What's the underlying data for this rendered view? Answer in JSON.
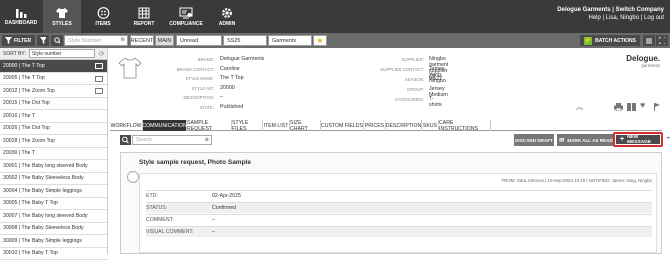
{
  "nav": {
    "items": [
      {
        "label": "DASHBOARD",
        "icon": "bar-chart-icon"
      },
      {
        "label": "STYLES",
        "icon": "shirt-icon"
      },
      {
        "label": "ITEMS",
        "icon": "buttons-icon"
      },
      {
        "label": "REPORT",
        "icon": "table-icon"
      },
      {
        "label": "COMPLIANCE",
        "icon": "compliance-icon"
      },
      {
        "label": "ADMIN",
        "icon": "gear-icon"
      }
    ],
    "company_line": "Delogue Garments | Switch Company",
    "user_line": "Help | Lisa, Ningbo | Log out"
  },
  "filterbar": {
    "filter_label": "FILTER",
    "search_placeholder": "Style Number",
    "recent_label": "RECENT",
    "main_label": "MAIN",
    "status_value": "Unread",
    "season_value": "SS25",
    "brand_value": "Garments",
    "batch_label": "BATCH ACTIONS"
  },
  "sort": {
    "label": "SORT BY:",
    "value": "Style number"
  },
  "styles_list": [
    "20000 | The T Top",
    "20005 | The T Top",
    "20012 | The Zoom Top",
    "20015 | The Dot Top",
    "20016 | The T",
    "20026 | The Dot Top",
    "20028 | The Zoom Top",
    "20030 | The T",
    "30001 | The Baby long sleeved Body",
    "30002 | The Baby Sleeveless Body",
    "30004 | The Baby Simple leggings",
    "30005 | The Baby T Top",
    "30007 | The Baby long sleeved Body",
    "30008 | The Baby Sleeveless Body",
    "30009 | The Baby Simple leggings",
    "30010 | The Baby T Top"
  ],
  "details_left": [
    {
      "k": "BRAND:",
      "v": "Delogue Garments"
    },
    {
      "k": "BRAND CONTACT:",
      "v": "Caroline"
    },
    {
      "k": "STYLE NAME:",
      "v": "The T Top"
    },
    {
      "k": "STYLE NO:",
      "v": "20000"
    },
    {
      "k": "DESCRIPTION:",
      "v": "–"
    },
    {
      "k": "STATE:",
      "v": "Published"
    }
  ],
  "details_right": [
    {
      "k": "SUPPLIER:",
      "v": "Ningbo garment supplier (2)"
    },
    {
      "k": "SUPPLIER CONTACT:",
      "v": "James Yang, Ningbo"
    },
    {
      "k": "SEASON:",
      "v": "SS27"
    },
    {
      "k": "GROUP:",
      "v": "Jersey Medium"
    },
    {
      "k": "CATEGORIES:",
      "v": "T-shirts"
    }
  ],
  "logo_text": "Delogue.",
  "logo_sub": "garments",
  "tabs": [
    "WORKFLOW",
    "COMMUNICATION",
    "SAMPLE REQUEST",
    "STYLE FILES",
    "ITEM LIST",
    "SIZE CHART",
    "CUSTOM FIELDS",
    "PRICES",
    "DESCRIPTION",
    "SKUS",
    "CARE INSTRUCTIONS"
  ],
  "comm_toolbar": {
    "search_placeholder": "Search",
    "discard_label": "DISCARD DRAFT",
    "mark_read_label": "MARK ALL AS READ",
    "new_message_label": "NEW MESSAGE",
    "more_label": "•••"
  },
  "message": {
    "title": "Style sample request, Photo Sample",
    "meta": "FROM: Sara Johnson | 10-Sep-2024 10:19 | NOTIFIED: James Yang, Ningbo",
    "fields": [
      {
        "k": "ETD:",
        "v": "02-Apr-2025"
      },
      {
        "k": "STATUS:",
        "v": "Confirmed"
      },
      {
        "k": "COMMENT:",
        "v": "–"
      },
      {
        "k": "VISUAL COMMENT:",
        "v": "–"
      }
    ]
  },
  "colors": {
    "accent": "#d32f2f",
    "dark": "#3a3a3a",
    "star": "#f2b81a",
    "green": "#7bbf3a"
  }
}
